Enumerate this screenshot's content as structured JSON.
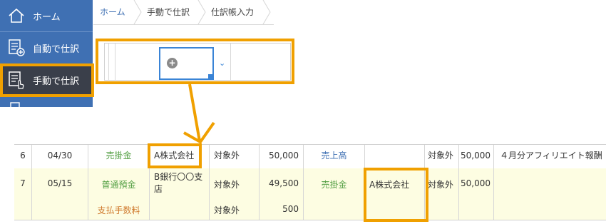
{
  "sidebar": {
    "items": [
      {
        "label": "ホーム",
        "icon": "home-icon"
      },
      {
        "label": "自動で仕訳",
        "icon": "document-add-icon"
      },
      {
        "label": "手動で仕訳",
        "icon": "document-hand-icon"
      }
    ]
  },
  "breadcrumb": [
    "ホーム",
    "手動で仕訳",
    "仕訳帳入力"
  ],
  "toolbar": {
    "add_icon": "plus-circle-icon",
    "dropdown_icon": "chevron-down-icon"
  },
  "table": {
    "rows": [
      {
        "no": "6",
        "date": "04/30",
        "debit_account": "売掛金",
        "debit_partner": "A株式会社",
        "debit_tax": "対象外",
        "debit_amount": "50,000",
        "credit_account": "売上高",
        "credit_partner": "",
        "credit_tax": "対象外",
        "credit_amount": "50,000",
        "memo": "４月分アフィリエイト報酬"
      },
      {
        "no": "7",
        "date": "05/15",
        "debit_account": "普通預金",
        "debit_account_2": "支払手数料",
        "debit_partner": "B銀行〇〇支店",
        "debit_tax": "対象外",
        "debit_tax_2": "対象外",
        "debit_amount": "49,500",
        "debit_amount_2": "500",
        "credit_account": "売掛金",
        "credit_partner": "A株式会社",
        "credit_tax": "対象外",
        "credit_amount": "50,000",
        "memo": ""
      }
    ]
  },
  "colors": {
    "sidebar": "#3f70b3",
    "sidebar_active": "#3a3f4a",
    "highlight": "#f0a000",
    "row_highlight": "#fdfde2"
  }
}
